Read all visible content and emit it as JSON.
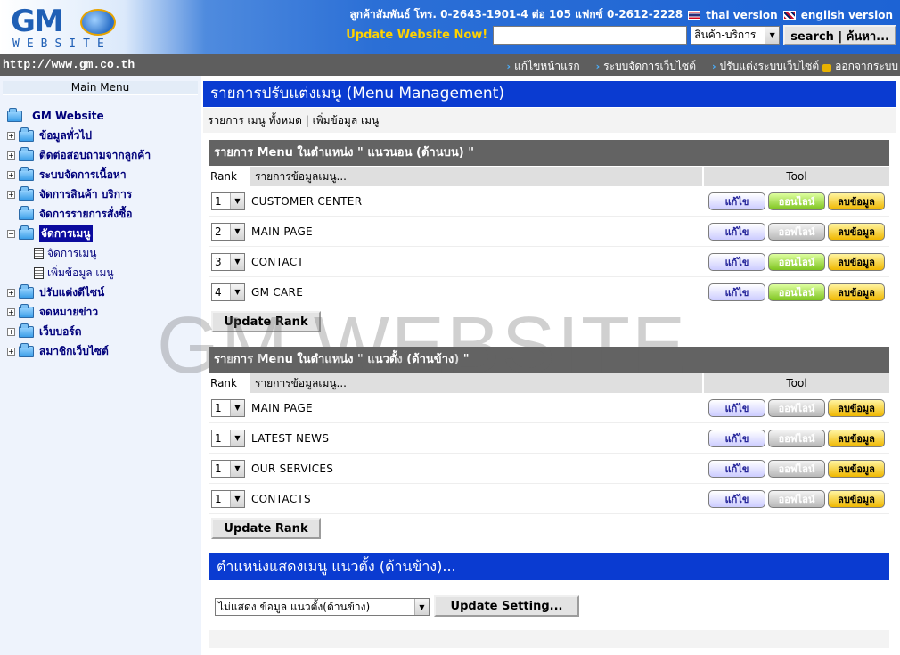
{
  "header": {
    "logo_text": "GM",
    "logo_sub": "WEBSITE",
    "contact": "ลูกค้าสัมพันธ์ โทร. 0-2643-1901-4 ต่อ 105 แฟกซ์ 0-2612-2228",
    "thai_version": "thai version",
    "english_version": "english version",
    "update_label": "Update Website Now!",
    "search_value": "",
    "category_selected": "สินค้า-บริการ",
    "search_button": "search | ค้นหา..."
  },
  "navbar": {
    "url": "http://www.gm.co.th",
    "links": [
      "แก้ไขหน้าแรก",
      "ระบบจัดการเว็บไซต์",
      "ปรับแต่งระบบเว็บไซต์",
      "ออกจากระบบ"
    ]
  },
  "sidebar": {
    "title": "Main Menu",
    "root": "GM Website",
    "items": [
      {
        "label": "ข้อมูลทั่วไป"
      },
      {
        "label": "ติดต่อสอบถามจากลูกค้า"
      },
      {
        "label": "ระบบจัดการเนื้อหา"
      },
      {
        "label": "จัดการสินค้า บริการ"
      },
      {
        "label": "จัดการรายการสั่งซื้อ"
      },
      {
        "label": "จัดการเมนู"
      },
      {
        "label": "ปรับแต่งดีไซน์"
      },
      {
        "label": "จดหมายข่าว"
      },
      {
        "label": "เว็บบอร์ด"
      },
      {
        "label": "สมาชิกเว็บไซต์"
      }
    ],
    "subitems": [
      "จัดการเมนู",
      "เพิ่มข้อมูล เมนู"
    ]
  },
  "main": {
    "page_title": "รายการปรับแต่งเมนู (Menu Management)",
    "all_items": "รายการ เมนู ทั้งหมด",
    "separator": "|",
    "add_item": "เพิ่มข้อมูล เมนู",
    "col_rank": "Rank",
    "col_name": "รายการข้อมูลเมนู...",
    "col_tool": "Tool",
    "btn_edit": "แก้ไข",
    "btn_online": "ออนไลน์",
    "btn_offline": "ออฟไลน์",
    "btn_delete": "ลบข้อมูล",
    "update_rank": "Update Rank",
    "horizontal": {
      "title": "รายการ Menu ในตำแหน่ง \" แนวนอน (ด้านบน) \"",
      "rows": [
        {
          "rank": "1",
          "name": "CUSTOMER CENTER",
          "status": "online"
        },
        {
          "rank": "2",
          "name": "MAIN PAGE",
          "status": "offline"
        },
        {
          "rank": "3",
          "name": "CONTACT",
          "status": "online"
        },
        {
          "rank": "4",
          "name": "GM CARE",
          "status": "online"
        }
      ]
    },
    "vertical": {
      "title": "รายการ Menu ในตำแหน่ง \" แนวตั้ง (ด้านข้าง) \"",
      "rows": [
        {
          "rank": "1",
          "name": "MAIN PAGE",
          "status": "offline"
        },
        {
          "rank": "1",
          "name": "LATEST NEWS",
          "status": "offline"
        },
        {
          "rank": "1",
          "name": "OUR SERVICES",
          "status": "offline"
        },
        {
          "rank": "1",
          "name": "CONTACTS",
          "status": "offline"
        }
      ]
    },
    "setting_title": "ตำแหน่งแสดงเมนู แนวตั้ง (ด้านข้าง)...",
    "setting_selected": "ไม่แสดง ข้อมูล แนวตั้ง(ด้านข้าง)",
    "update_setting": "Update Setting..."
  },
  "watermark": "GM WEBSITE",
  "colors": {
    "header_blue": "#1d63d4",
    "title_blue": "#0a3bd1",
    "panel_gray": "#636363",
    "online_green": "#7ec41f",
    "delete_yellow": "#f0b800"
  }
}
